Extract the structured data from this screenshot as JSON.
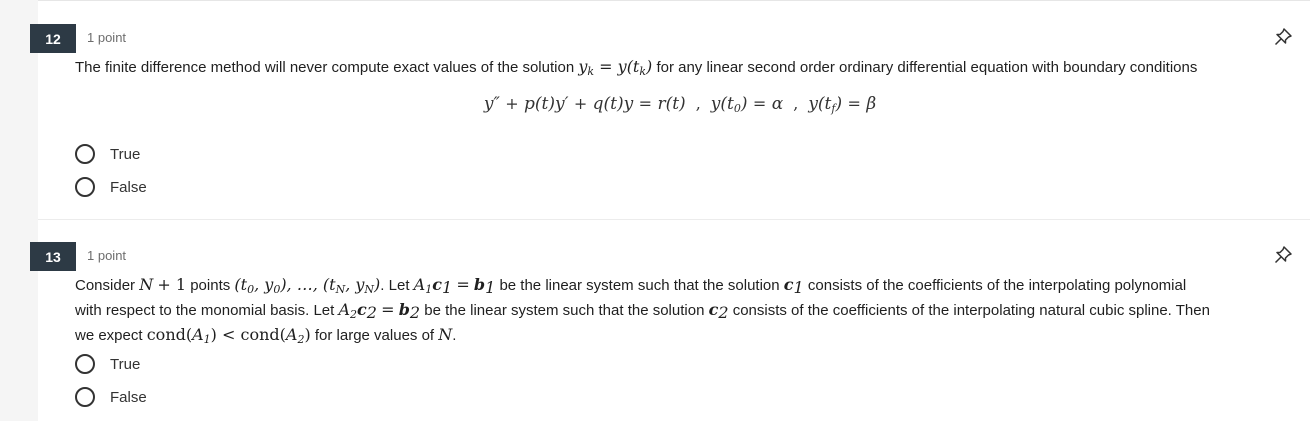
{
  "questions": [
    {
      "number": "12",
      "points": "1 point",
      "text_a": "The finite difference method will never compute exact values of the solution ",
      "text_b": " for any linear second order ordinary differential equation with boundary conditions",
      "options": [
        {
          "label": "True"
        },
        {
          "label": "False"
        }
      ]
    },
    {
      "number": "13",
      "points": "1 point",
      "t1": "Consider ",
      "t2": " points ",
      "t3": ". Let ",
      "t4": " be the linear system such that the solution ",
      "t5": " consists of the coefficients of the interpolating polynomial",
      "t6": "with respect to the monomial basis. Let ",
      "t7": " be the linear system such that the solution ",
      "t8": " consists of the coefficients of the interpolating natural cubic spline. Then",
      "t9": "we expect ",
      "t10": " for large values of ",
      "t11": ".",
      "options": [
        {
          "label": "True"
        },
        {
          "label": "False"
        }
      ]
    }
  ],
  "icons": {
    "pin": "pin-icon"
  }
}
